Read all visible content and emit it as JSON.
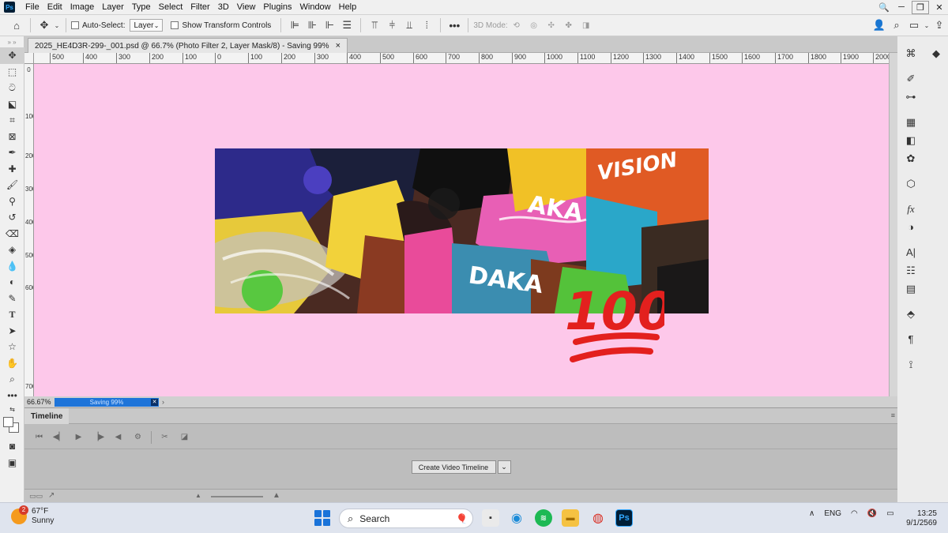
{
  "app": {
    "logo_text": "Ps",
    "menu": [
      "File",
      "Edit",
      "Image",
      "Layer",
      "Type",
      "Select",
      "Filter",
      "3D",
      "View",
      "Plugins",
      "Window",
      "Help"
    ]
  },
  "options_bar": {
    "auto_select_label": "Auto-Select:",
    "auto_select_value": "Layer",
    "show_transform_label": "Show Transform Controls",
    "mode_3d_label": "3D Mode:",
    "more_label": "•••"
  },
  "document": {
    "tab_title": "2025_HE4D3R-299-_001.psd @ 66.7% (Photo Filter 2, Layer Mask/8) - Saving 99%",
    "tab_close": "×",
    "zoom": "66.67%",
    "progress_text": "Saving 99%",
    "progress_fraction": 0.99,
    "canvas_color": "#fdc8ea",
    "artwork_text": [
      "VISION",
      "AKA",
      "DAKA"
    ],
    "sticker_text": "100"
  },
  "rulers": {
    "horizontal": [
      "500",
      "400",
      "300",
      "200",
      "100",
      "0",
      "100",
      "200",
      "300",
      "400",
      "500",
      "600",
      "700",
      "800",
      "900",
      "1000",
      "1100",
      "1200",
      "1300",
      "1400",
      "1500",
      "1600",
      "1700",
      "1800",
      "1900",
      "2000"
    ],
    "vertical": [
      "0",
      "100",
      "200",
      "300",
      "400",
      "500",
      "600",
      "700"
    ]
  },
  "timeline": {
    "tab_label": "Timeline",
    "create_button": "Create Video Timeline",
    "dropdown_icon": "chevron-down-icon"
  },
  "taskbar": {
    "weather_badge": "2",
    "weather_temp": "67°F",
    "weather_desc": "Sunny",
    "search_placeholder": "Search",
    "language": "ENG",
    "time": "13:25",
    "date": "9/1/2569",
    "ps_label": "Ps"
  },
  "colors": {
    "accent": "#1e74d9",
    "canvas": "#fdc8ea",
    "sticker_red": "#e3201e"
  }
}
